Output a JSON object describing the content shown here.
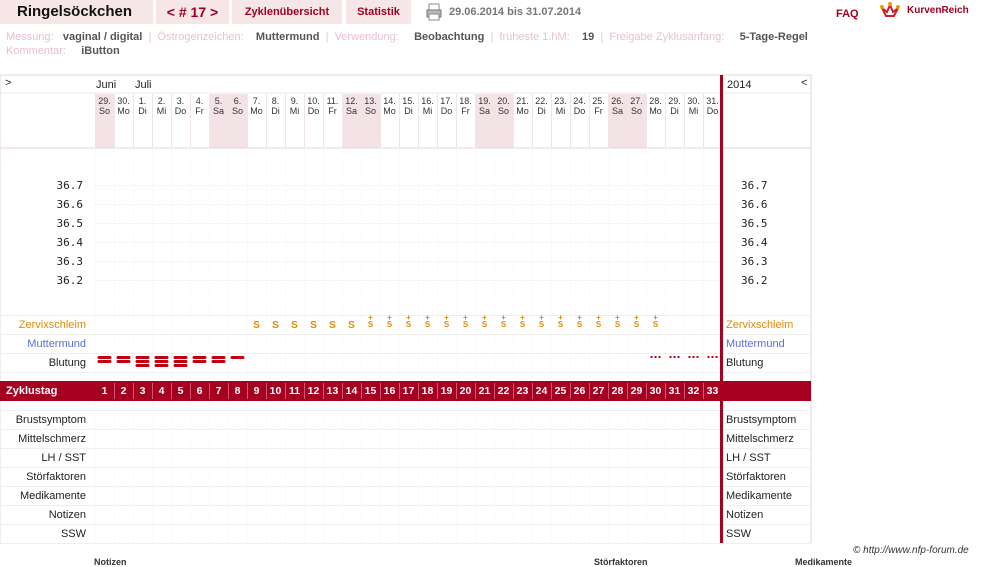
{
  "header": {
    "title": "Ringelsöckchen",
    "nav": "< # 17 >",
    "tab_overview": "Zyklenübersicht",
    "tab_stats": "Statistik",
    "period": "29.06.2014 bis 31.07.2014",
    "faq": "FAQ",
    "brand": "KurvenReich"
  },
  "info": {
    "messung_label": "Messung:",
    "messung_value": "vaginal / digital",
    "oestrogen_label": "Östrogenzeichen:",
    "oestrogen_value": "Muttermund",
    "verwendung_label": "Verwendung:",
    "verwendung_value": "Beobachtung",
    "fhm_label": "früheste 1.hM:",
    "fhm_value": "19",
    "freigabe_label": "Freigabe Zyklusanfang:",
    "freigabe_value": "5-Tage-Regel",
    "kommentar_label": "Kommentar:",
    "kommentar_value": "iButton"
  },
  "chart_header": {
    "left_arrow": ">",
    "right_arrow": "<",
    "year": "2014",
    "month1": "Juni",
    "month2": "Juli"
  },
  "days": [
    {
      "d": "29.",
      "w": "So",
      "we": true
    },
    {
      "d": "30.",
      "w": "Mo",
      "we": false
    },
    {
      "d": "1.",
      "w": "Di",
      "we": false
    },
    {
      "d": "2.",
      "w": "Mi",
      "we": false
    },
    {
      "d": "3.",
      "w": "Do",
      "we": false
    },
    {
      "d": "4.",
      "w": "Fr",
      "we": false
    },
    {
      "d": "5.",
      "w": "Sa",
      "we": true
    },
    {
      "d": "6.",
      "w": "So",
      "we": true
    },
    {
      "d": "7.",
      "w": "Mo",
      "we": false
    },
    {
      "d": "8.",
      "w": "Di",
      "we": false
    },
    {
      "d": "9.",
      "w": "Mi",
      "we": false
    },
    {
      "d": "10.",
      "w": "Do",
      "we": false
    },
    {
      "d": "11.",
      "w": "Fr",
      "we": false
    },
    {
      "d": "12.",
      "w": "Sa",
      "we": true
    },
    {
      "d": "13.",
      "w": "So",
      "we": true
    },
    {
      "d": "14.",
      "w": "Mo",
      "we": false
    },
    {
      "d": "15.",
      "w": "Di",
      "we": false
    },
    {
      "d": "16.",
      "w": "Mi",
      "we": false
    },
    {
      "d": "17.",
      "w": "Do",
      "we": false
    },
    {
      "d": "18.",
      "w": "Fr",
      "we": false
    },
    {
      "d": "19.",
      "w": "Sa",
      "we": true
    },
    {
      "d": "20.",
      "w": "So",
      "we": true
    },
    {
      "d": "21.",
      "w": "Mo",
      "we": false
    },
    {
      "d": "22.",
      "w": "Di",
      "we": false
    },
    {
      "d": "23.",
      "w": "Mi",
      "we": false
    },
    {
      "d": "24.",
      "w": "Do",
      "we": false
    },
    {
      "d": "25.",
      "w": "Fr",
      "we": false
    },
    {
      "d": "26.",
      "w": "Sa",
      "we": true
    },
    {
      "d": "27.",
      "w": "So",
      "we": true
    },
    {
      "d": "28.",
      "w": "Mo",
      "we": false
    },
    {
      "d": "29.",
      "w": "Di",
      "we": false
    },
    {
      "d": "30.",
      "w": "Mi",
      "we": false
    },
    {
      "d": "31.",
      "w": "Do",
      "we": false
    }
  ],
  "temp_labels": [
    "36.7",
    "36.6",
    "36.5",
    "36.4",
    "36.3",
    "36.2"
  ],
  "rows": {
    "zervix": "Zervixschleim",
    "muttermund": "Muttermund",
    "blutung": "Blutung",
    "zyklustag": "Zyklustag",
    "lower": [
      "Brustsymptom",
      "Mittelschmerz",
      "LH / SST",
      "Störfaktoren",
      "Medikamente",
      "Notizen",
      "SSW"
    ]
  },
  "zervix_marks": [
    "",
    "",
    "",
    "",
    "",
    "",
    "",
    "",
    "S",
    "S",
    "S",
    "S",
    "S",
    "S",
    "S+",
    "S+",
    "S+",
    "S+",
    "S+",
    "S+",
    "S+",
    "S+",
    "S+",
    "S+",
    "S+",
    "S+",
    "S+",
    "S+",
    "S+",
    "S+",
    "",
    "",
    ""
  ],
  "blutung_levels": [
    2,
    2,
    3,
    3,
    3,
    2,
    2,
    1,
    0,
    0,
    0,
    0,
    0,
    0,
    0,
    0,
    0,
    0,
    0,
    0,
    0,
    0,
    0,
    0,
    0,
    0,
    0,
    0,
    0,
    -1,
    -1,
    -1,
    -1
  ],
  "colors": {
    "accent": "#a50020",
    "weekend": "#f3e3e6",
    "zervix": "#e08a00",
    "muttermund": "#5a6fd0"
  },
  "footer": {
    "credit": "© http://www.nfp-forum.de",
    "notizen": "Notizen",
    "stoerfaktoren": "Störfaktoren",
    "medikamente": "Medikamente"
  }
}
